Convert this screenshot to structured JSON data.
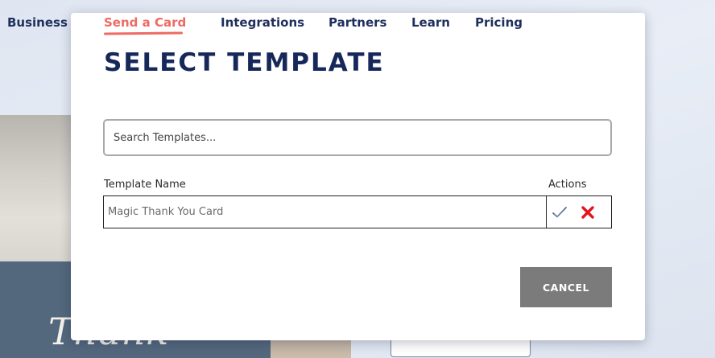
{
  "background_nav": {
    "business_label": "Business"
  },
  "background": {
    "script_text": "Thank"
  },
  "nav": {
    "items": [
      {
        "label": "Send a Card",
        "active": true
      },
      {
        "label": "Integrations",
        "active": false
      },
      {
        "label": "Partners",
        "active": false
      },
      {
        "label": "Learn",
        "active": false
      },
      {
        "label": "Pricing",
        "active": false
      }
    ]
  },
  "modal": {
    "title": "SELECT TEMPLATE",
    "search": {
      "placeholder": "Search Templates...",
      "value": ""
    },
    "table": {
      "headers": {
        "name": "Template Name",
        "actions": "Actions"
      },
      "rows": [
        {
          "name": "Magic Thank You Card",
          "actions": [
            "check-icon",
            "close-icon"
          ]
        }
      ]
    },
    "cancel_label": "CANCEL"
  },
  "colors": {
    "nav_text": "#1f2f5c",
    "nav_active": "#ee6a63",
    "title": "#16275a",
    "cancel_bg": "#7b7b7b",
    "delete_icon": "#e2141c",
    "check_icon": "#3c5382"
  }
}
